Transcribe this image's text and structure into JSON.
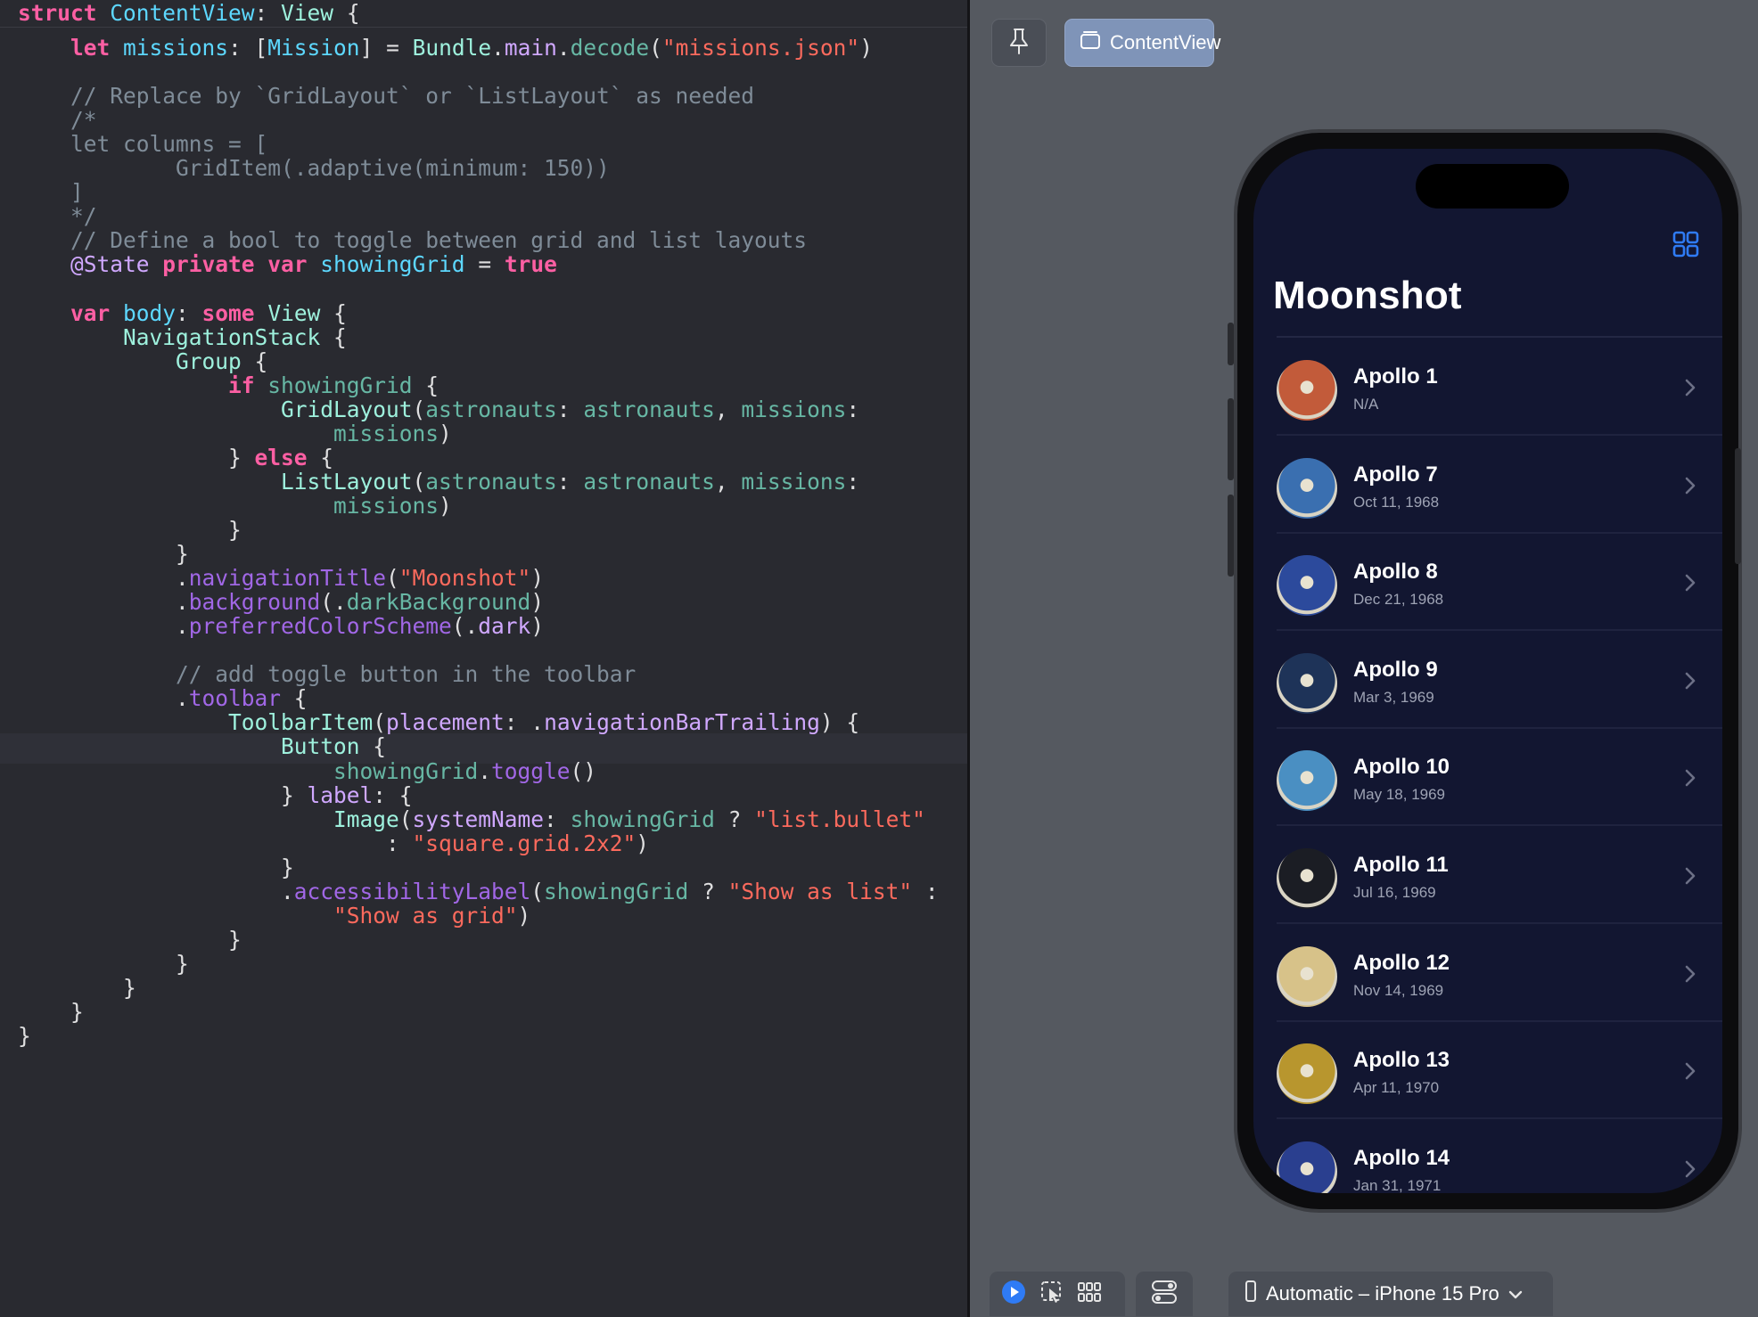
{
  "editor": {
    "sticky_header": [
      {
        "t": "struct ",
        "c": "k"
      },
      {
        "t": "ContentView",
        "c": "ty"
      },
      {
        "t": ": ",
        "c": "p"
      },
      {
        "t": "View",
        "c": "ot"
      },
      {
        "t": " {",
        "c": "p"
      }
    ],
    "lines": [
      [
        {
          "t": "    let ",
          "c": "k"
        },
        {
          "t": "missions",
          "c": "ty"
        },
        {
          "t": ": [",
          "c": "p"
        },
        {
          "t": "Mission",
          "c": "ty"
        },
        {
          "t": "] = ",
          "c": "p"
        },
        {
          "t": "Bundle",
          "c": "ot"
        },
        {
          "t": ".",
          "c": "p"
        },
        {
          "t": "main",
          "c": "pt"
        },
        {
          "t": ".",
          "c": "p"
        },
        {
          "t": "decode",
          "c": "ar"
        },
        {
          "t": "(",
          "c": "p"
        },
        {
          "t": "\"missions.json\"",
          "c": "s"
        },
        {
          "t": ")",
          "c": "p"
        }
      ],
      [],
      [
        {
          "t": "    // Replace by `GridLayout` or `ListLayout` as needed",
          "c": "c"
        }
      ],
      [
        {
          "t": "    /*",
          "c": "c"
        }
      ],
      [
        {
          "t": "    let columns = [",
          "c": "c"
        }
      ],
      [
        {
          "t": "            GridItem(.adaptive(minimum: 150))",
          "c": "c"
        }
      ],
      [
        {
          "t": "    ]",
          "c": "c"
        }
      ],
      [
        {
          "t": "    */",
          "c": "c"
        }
      ],
      [
        {
          "t": "    // Define a bool to toggle between grid and list layouts",
          "c": "c"
        }
      ],
      [
        {
          "t": "    @State ",
          "c": "pt"
        },
        {
          "t": "private ",
          "c": "k"
        },
        {
          "t": "var ",
          "c": "k"
        },
        {
          "t": "showingGrid",
          "c": "ty"
        },
        {
          "t": " = ",
          "c": "p"
        },
        {
          "t": "true",
          "c": "k"
        }
      ],
      [],
      [
        {
          "t": "    var ",
          "c": "k"
        },
        {
          "t": "body",
          "c": "ty"
        },
        {
          "t": ": ",
          "c": "p"
        },
        {
          "t": "some ",
          "c": "k"
        },
        {
          "t": "View",
          "c": "ot"
        },
        {
          "t": " {",
          "c": "p"
        }
      ],
      [
        {
          "t": "        NavigationStack",
          "c": "ot"
        },
        {
          "t": " {",
          "c": "p"
        }
      ],
      [
        {
          "t": "            Group",
          "c": "ot"
        },
        {
          "t": " {",
          "c": "p"
        }
      ],
      [
        {
          "t": "                if ",
          "c": "k"
        },
        {
          "t": "showingGrid",
          "c": "ar"
        },
        {
          "t": " {",
          "c": "p"
        }
      ],
      [
        {
          "t": "                    GridLayout",
          "c": "ot"
        },
        {
          "t": "(",
          "c": "p"
        },
        {
          "t": "astronauts",
          "c": "ar"
        },
        {
          "t": ": ",
          "c": "p"
        },
        {
          "t": "astronauts",
          "c": "ar"
        },
        {
          "t": ", ",
          "c": "p"
        },
        {
          "t": "missions",
          "c": "ar"
        },
        {
          "t": ":",
          "c": "p"
        }
      ],
      [
        {
          "t": "                        missions",
          "c": "ar"
        },
        {
          "t": ")",
          "c": "p"
        }
      ],
      [
        {
          "t": "                } ",
          "c": "p"
        },
        {
          "t": "else",
          "c": "k"
        },
        {
          "t": " {",
          "c": "p"
        }
      ],
      [
        {
          "t": "                    ListLayout",
          "c": "ot"
        },
        {
          "t": "(",
          "c": "p"
        },
        {
          "t": "astronauts",
          "c": "ar"
        },
        {
          "t": ": ",
          "c": "p"
        },
        {
          "t": "astronauts",
          "c": "ar"
        },
        {
          "t": ", ",
          "c": "p"
        },
        {
          "t": "missions",
          "c": "ar"
        },
        {
          "t": ":",
          "c": "p"
        }
      ],
      [
        {
          "t": "                        missions",
          "c": "ar"
        },
        {
          "t": ")",
          "c": "p"
        }
      ],
      [
        {
          "t": "                }",
          "c": "p"
        }
      ],
      [
        {
          "t": "            }",
          "c": "p"
        }
      ],
      [
        {
          "t": "            .",
          "c": "p"
        },
        {
          "t": "navigationTitle",
          "c": "fn"
        },
        {
          "t": "(",
          "c": "p"
        },
        {
          "t": "\"Moonshot\"",
          "c": "s"
        },
        {
          "t": ")",
          "c": "p"
        }
      ],
      [
        {
          "t": "            .",
          "c": "p"
        },
        {
          "t": "background",
          "c": "fn"
        },
        {
          "t": "(.",
          "c": "p"
        },
        {
          "t": "darkBackground",
          "c": "ar"
        },
        {
          "t": ")",
          "c": "p"
        }
      ],
      [
        {
          "t": "            .",
          "c": "p"
        },
        {
          "t": "preferredColorScheme",
          "c": "fn"
        },
        {
          "t": "(.",
          "c": "p"
        },
        {
          "t": "dark",
          "c": "pt"
        },
        {
          "t": ")",
          "c": "p"
        }
      ],
      [],
      [
        {
          "t": "            // add toggle button in the toolbar",
          "c": "c"
        }
      ],
      [
        {
          "t": "            .",
          "c": "p"
        },
        {
          "t": "toolbar",
          "c": "fn"
        },
        {
          "t": " {",
          "c": "p"
        }
      ],
      [
        {
          "t": "                ToolbarItem",
          "c": "ot"
        },
        {
          "t": "(",
          "c": "p"
        },
        {
          "t": "placement",
          "c": "pt"
        },
        {
          "t": ": .",
          "c": "p"
        },
        {
          "t": "navigationBarTrailing",
          "c": "pt"
        },
        {
          "t": ") {",
          "c": "p"
        }
      ],
      [
        {
          "t": "                    Button",
          "c": "ot"
        },
        {
          "t": " {",
          "c": "p"
        }
      ],
      [
        {
          "t": "                        showingGrid",
          "c": "ar"
        },
        {
          "t": ".",
          "c": "p"
        },
        {
          "t": "toggle",
          "c": "fn"
        },
        {
          "t": "()",
          "c": "p"
        }
      ],
      [
        {
          "t": "                    } ",
          "c": "p"
        },
        {
          "t": "label",
          "c": "pt"
        },
        {
          "t": ": {",
          "c": "p"
        }
      ],
      [
        {
          "t": "                        Image",
          "c": "ot"
        },
        {
          "t": "(",
          "c": "p"
        },
        {
          "t": "systemName",
          "c": "pt"
        },
        {
          "t": ": ",
          "c": "p"
        },
        {
          "t": "showingGrid",
          "c": "ar"
        },
        {
          "t": " ? ",
          "c": "p"
        },
        {
          "t": "\"list.bullet\"",
          "c": "s"
        }
      ],
      [
        {
          "t": "                            : ",
          "c": "p"
        },
        {
          "t": "\"square.grid.2x2\"",
          "c": "s"
        },
        {
          "t": ")",
          "c": "p"
        }
      ],
      [
        {
          "t": "                    }",
          "c": "p"
        }
      ],
      [
        {
          "t": "                    .",
          "c": "p"
        },
        {
          "t": "accessibilityLabel",
          "c": "fn"
        },
        {
          "t": "(",
          "c": "p"
        },
        {
          "t": "showingGrid",
          "c": "ar"
        },
        {
          "t": " ? ",
          "c": "p"
        },
        {
          "t": "\"Show as list\"",
          "c": "s"
        },
        {
          "t": " :",
          "c": "p"
        }
      ],
      [
        {
          "t": "                        ",
          "c": "p"
        },
        {
          "t": "\"Show as grid\"",
          "c": "s"
        },
        {
          "t": ")",
          "c": "p"
        }
      ],
      [
        {
          "t": "                }",
          "c": "p"
        }
      ],
      [
        {
          "t": "            }",
          "c": "p"
        }
      ],
      [
        {
          "t": "        }",
          "c": "p"
        }
      ],
      [
        {
          "t": "    }",
          "c": "p"
        }
      ],
      [
        {
          "t": "}",
          "c": "p"
        }
      ]
    ],
    "current_line": 29
  },
  "canvas": {
    "tab_label": "ContentView",
    "device_label": "Automatic – iPhone 15 Pro",
    "icons": {
      "pin": "pin-icon",
      "tab": "window-icon",
      "play": "play-icon",
      "select": "selectable-mode-icon",
      "variants": "variants-grid-icon",
      "settings": "device-settings-icon",
      "device": "iphone-icon",
      "chevron": "chevron-down-icon"
    }
  },
  "app": {
    "title": "Moonshot",
    "toolbar_icon": "square-grid-2x2-icon",
    "accent": "#2f7bf5",
    "missions": [
      {
        "name": "Apollo 1",
        "date": "N/A",
        "patch": "#c25b3a"
      },
      {
        "name": "Apollo 7",
        "date": "Oct 11, 1968",
        "patch": "#3a6fb0"
      },
      {
        "name": "Apollo 8",
        "date": "Dec 21, 1968",
        "patch": "#2c4a9c"
      },
      {
        "name": "Apollo 9",
        "date": "Mar 3, 1969",
        "patch": "#1e3358"
      },
      {
        "name": "Apollo 10",
        "date": "May 18, 1969",
        "patch": "#4a8fc2"
      },
      {
        "name": "Apollo 11",
        "date": "Jul 16, 1969",
        "patch": "#1b1d24"
      },
      {
        "name": "Apollo 12",
        "date": "Nov 14, 1969",
        "patch": "#d7c289"
      },
      {
        "name": "Apollo 13",
        "date": "Apr 11, 1970",
        "patch": "#b8962e"
      },
      {
        "name": "Apollo 14",
        "date": "Jan 31, 1971",
        "patch": "#2a3f8f"
      }
    ]
  }
}
